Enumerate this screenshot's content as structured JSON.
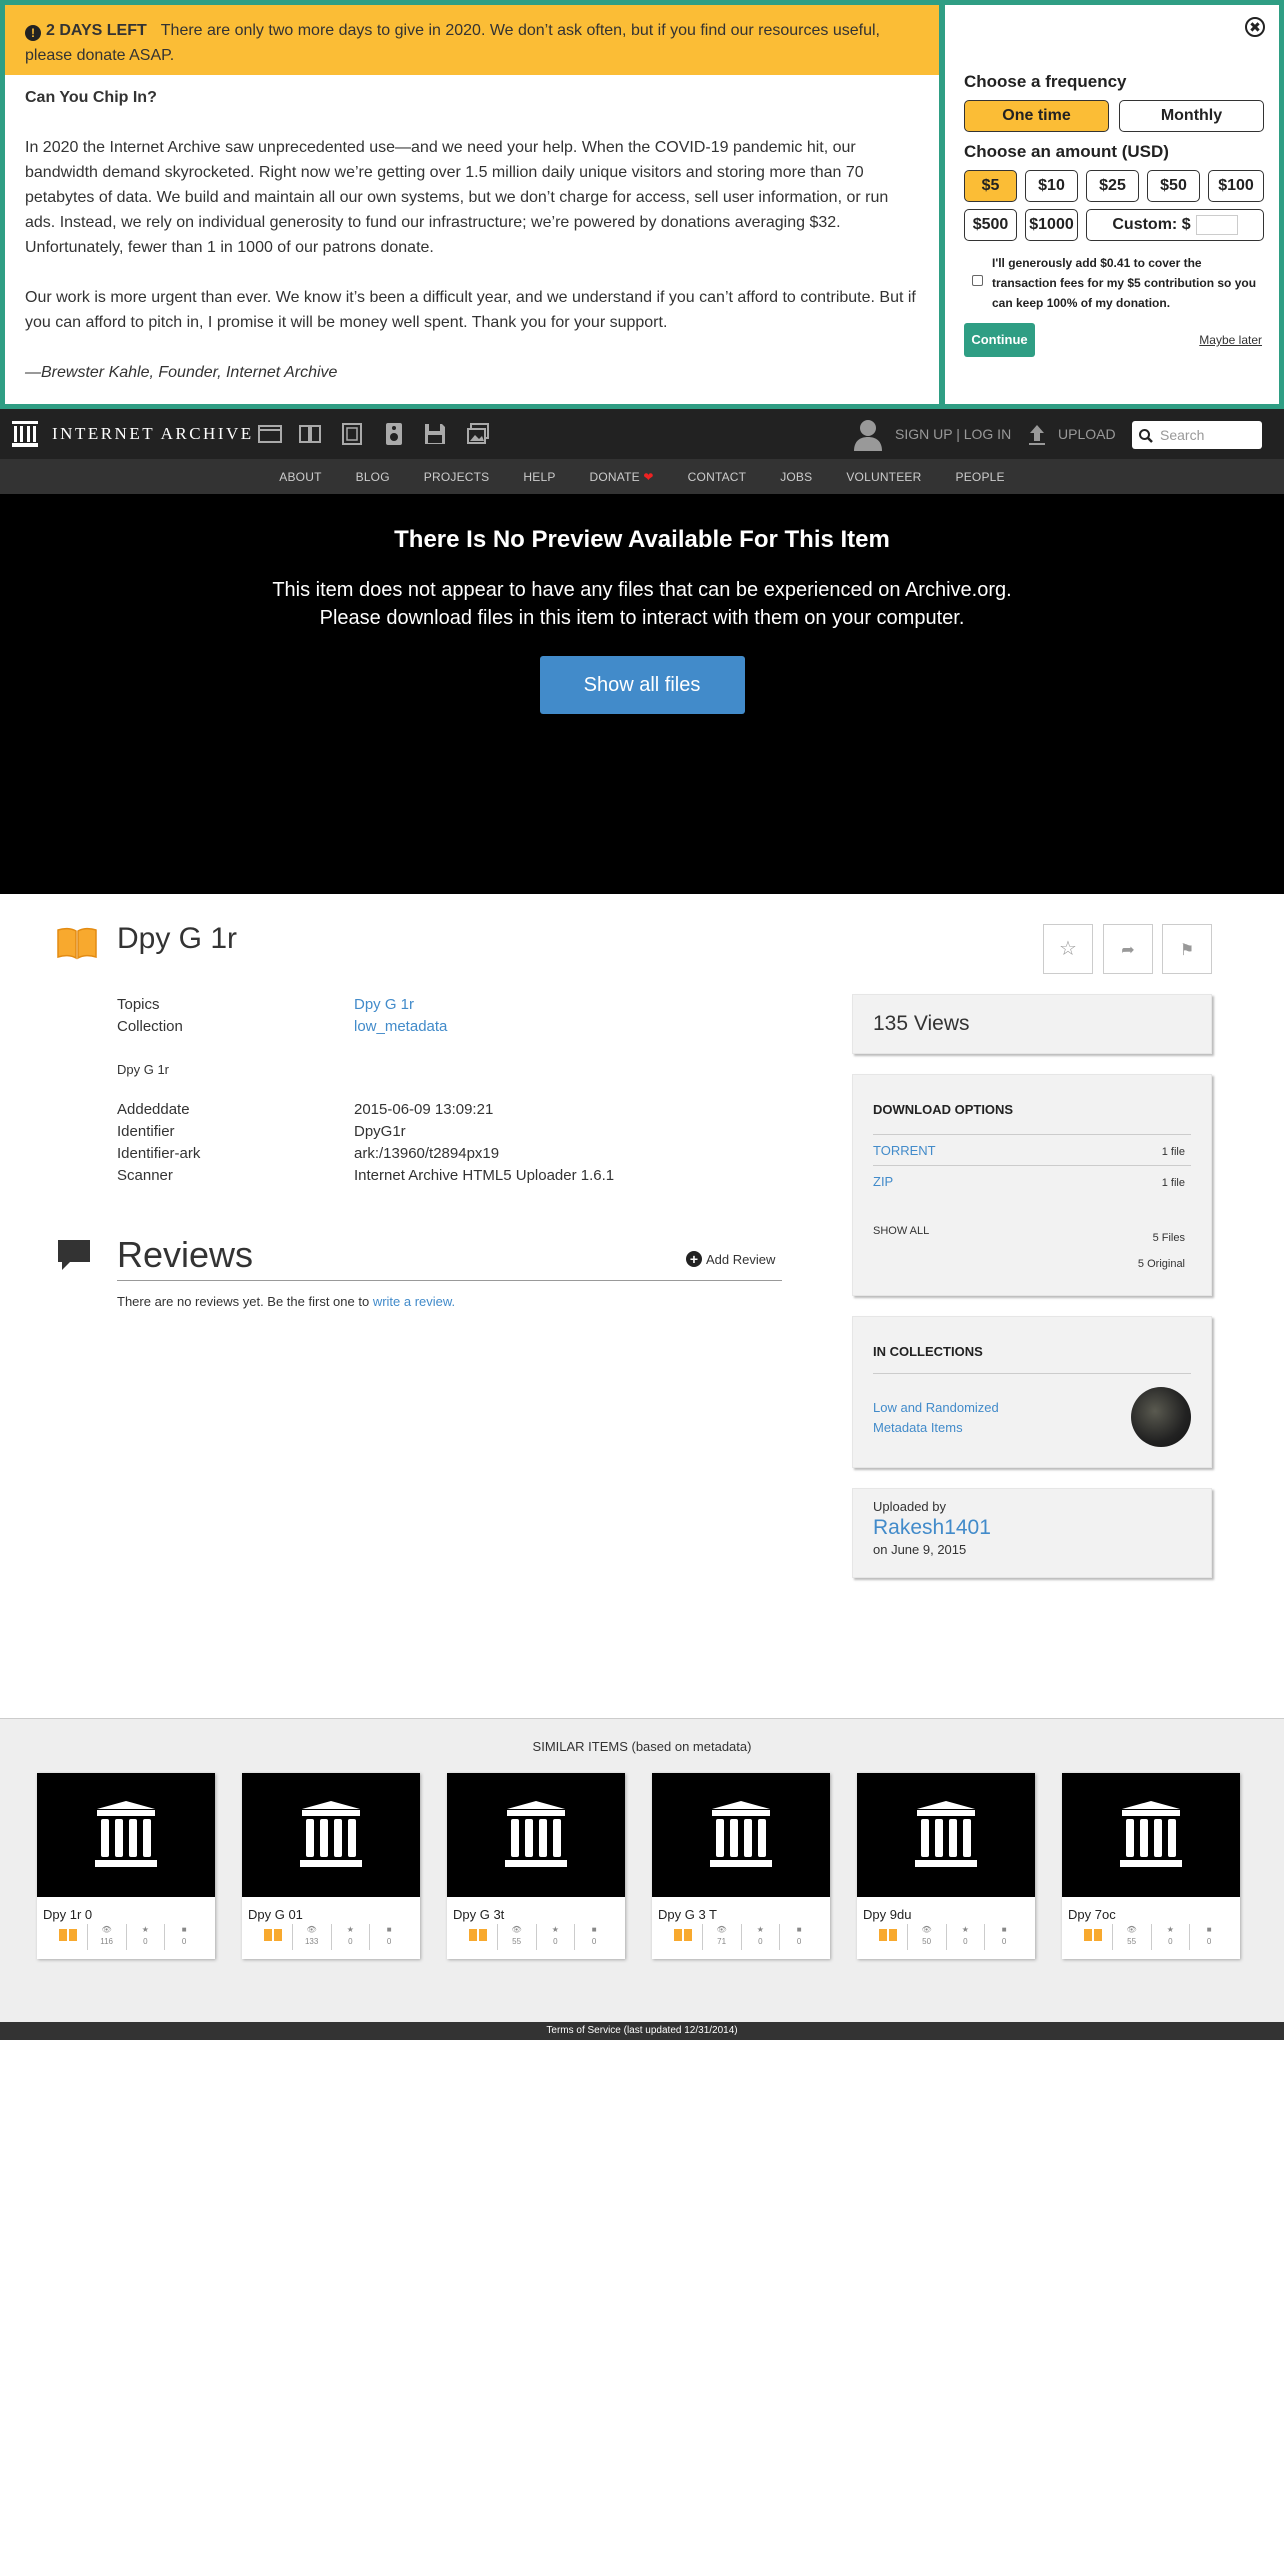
{
  "banner": {
    "days_left": "2 DAYS LEFT",
    "alert_text": "There are only two more days to give in 2020. We don’t ask often, but if you find our resources useful, please donate ASAP.",
    "heading": "Can You Chip In?",
    "para1": "In 2020 the Internet Archive saw unprecedented use—and we need your help. When the COVID-19 pandemic hit, our bandwidth demand skyrocketed. Right now we’re getting over 1.5 million daily unique visitors and storing more than 70 petabytes of data. We build and maintain all our own systems, but we don’t charge for access, sell user information, or run ads. Instead, we rely on individual generosity to fund our infrastructure; we’re powered by donations averaging $32. Unfortunately, fewer than 1 in 1000 of our patrons donate.",
    "para2": "Our work is more urgent than ever. We know it’s been a difficult year, and we understand if you can’t afford to contribute. But if you can afford to pitch in, I promise it will be money well spent. Thank you for your support.",
    "signature": "—Brewster Kahle, Founder, Internet Archive",
    "freq_heading": "Choose a frequency",
    "freq_one_time": "One time",
    "freq_monthly": "Monthly",
    "amount_heading": "Choose an amount (USD)",
    "amounts": [
      "$5",
      "$10",
      "$25",
      "$50",
      "$100",
      "$500",
      "$1000"
    ],
    "custom_label": "Custom: $",
    "fee_text": "I'll generously add $0.41 to cover the transaction fees for my $5 contribution so you can keep 100% of my donation.",
    "continue": "Continue",
    "maybe_later": "Maybe later",
    "close": "✖",
    "accent": "#2f9e84",
    "highlight": "#fbbd36"
  },
  "nav": {
    "logo": "INTERNET ARCHIVE",
    "signup": "SIGN UP | LOG IN",
    "upload": "UPLOAD",
    "search_placeholder": "Search",
    "links": [
      "ABOUT",
      "BLOG",
      "PROJECTS",
      "HELP",
      "DONATE",
      "CONTACT",
      "JOBS",
      "VOLUNTEER",
      "PEOPLE"
    ]
  },
  "preview": {
    "title": "There Is No Preview Available For This Item",
    "line1": "This item does not appear to have any files that can be experienced on Archive.org.",
    "line2": "Please download files in this item to interact with them on your computer.",
    "button": "Show all files"
  },
  "item": {
    "title": "Dpy G 1r",
    "topics_label": "Topics",
    "topics_value": "Dpy G 1r",
    "collection_label": "Collection",
    "collection_value": "low_metadata",
    "description": "Dpy G 1r",
    "addeddate_label": "Addeddate",
    "addeddate_value": "2015-06-09 13:09:21",
    "identifier_label": "Identifier",
    "identifier_value": "DpyG1r",
    "ark_label": "Identifier-ark",
    "ark_value": "ark:/13960/t2894px19",
    "scanner_label": "Scanner",
    "scanner_value": "Internet Archive HTML5 Uploader 1.6.1"
  },
  "reviews": {
    "heading": "Reviews",
    "add": "Add Review",
    "empty_text": "There are no reviews yet. Be the first one to",
    "empty_link": "write a review."
  },
  "sidebar": {
    "views": "135 Views",
    "download_heading": "DOWNLOAD OPTIONS",
    "downloads": [
      {
        "name": "TORRENT",
        "count": "1 file"
      },
      {
        "name": "ZIP",
        "count": "1 file"
      }
    ],
    "show_all": "SHOW ALL",
    "files": "5 Files",
    "original": "5 Original",
    "collections_heading": "IN COLLECTIONS",
    "collection_link": "Low and Randomized Metadata Items",
    "uploaded_by_label": "Uploaded by",
    "uploader": "Rakesh1401",
    "uploaded_on": "on June 9, 2015"
  },
  "similar": {
    "heading": "SIMILAR ITEMS (based on metadata)",
    "items": [
      {
        "title": "Dpy 1r 0",
        "views": "116",
        "favs": "0",
        "reviews": "0"
      },
      {
        "title": "Dpy G 01",
        "views": "133",
        "favs": "0",
        "reviews": "0"
      },
      {
        "title": "Dpy G 3t",
        "views": "55",
        "favs": "0",
        "reviews": "0"
      },
      {
        "title": "Dpy G 3 T",
        "views": "71",
        "favs": "0",
        "reviews": "0"
      },
      {
        "title": "Dpy 9du",
        "views": "50",
        "favs": "0",
        "reviews": "0"
      },
      {
        "title": "Dpy 7oc",
        "views": "55",
        "favs": "0",
        "reviews": "0"
      }
    ]
  },
  "footer": {
    "text": "Terms of Service (last updated 12/31/2014)"
  }
}
